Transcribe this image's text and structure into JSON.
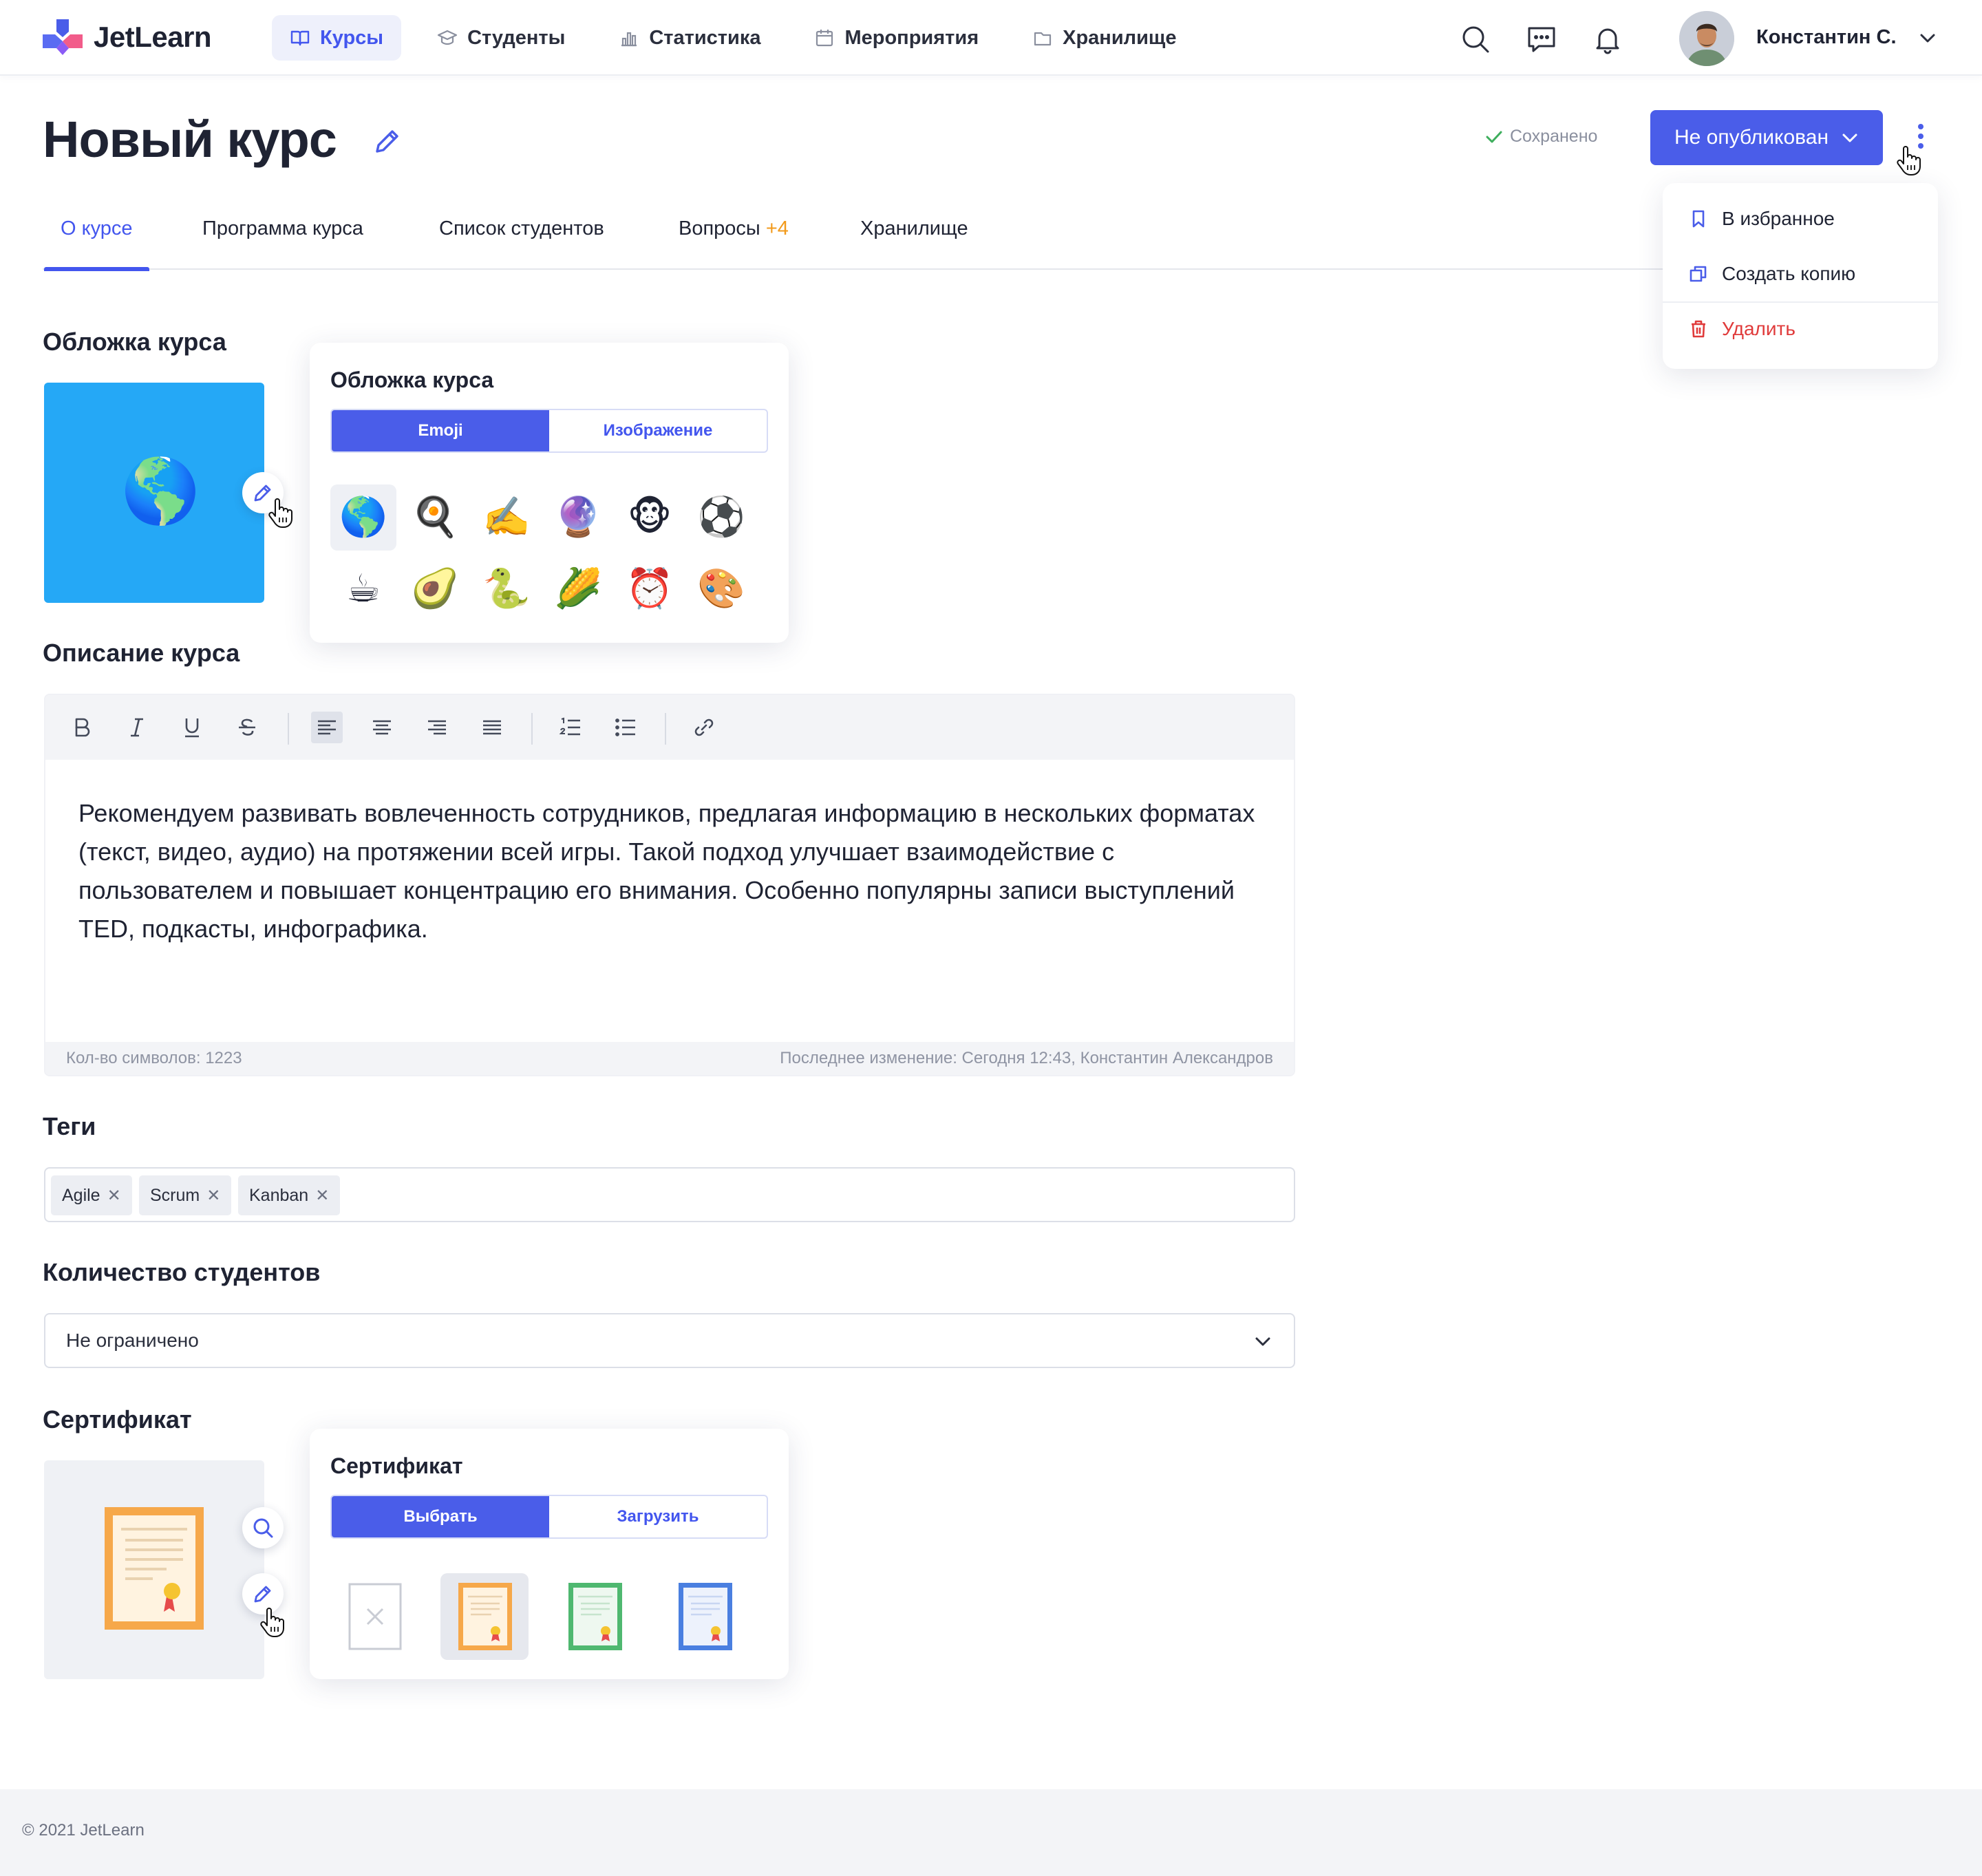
{
  "app": {
    "logo_text": "JetLearn"
  },
  "nav": {
    "items": [
      {
        "label": "Курсы",
        "icon": "book-icon",
        "active": true
      },
      {
        "label": "Студенты",
        "icon": "graduation-cap-icon",
        "active": false
      },
      {
        "label": "Статистика",
        "icon": "bar-chart-icon",
        "active": false
      },
      {
        "label": "Мероприятия",
        "icon": "calendar-icon",
        "active": false
      },
      {
        "label": "Хранилище",
        "icon": "folder-icon",
        "active": false
      }
    ]
  },
  "header_icons": [
    "search-icon",
    "chat-icon",
    "bell-icon"
  ],
  "user": {
    "name": "Константин С."
  },
  "page": {
    "title": "Новый курс",
    "saved_status": "Сохранено",
    "publish_label": "Не опубликован"
  },
  "tabs": [
    {
      "label": "О курсе",
      "active": true
    },
    {
      "label": "Программа курса"
    },
    {
      "label": "Список студентов"
    },
    {
      "label": "Вопросы",
      "count": "+4"
    },
    {
      "label": "Хранилище"
    }
  ],
  "more_menu": {
    "items": [
      {
        "label": "В избранное",
        "icon": "bookmark-icon"
      },
      {
        "label": "Создать копию",
        "icon": "copy-icon"
      },
      {
        "label": "Удалить",
        "icon": "trash-icon",
        "color": "#e03b3b"
      }
    ]
  },
  "cover": {
    "label": "Обложка курса",
    "popover": {
      "title": "Обложка курса",
      "tabs": [
        "Emoji",
        "Изображение"
      ],
      "active_tab": "Emoji",
      "emojis": [
        "🌎",
        "🍳",
        "✍️",
        "🔮",
        "🐵",
        "⚽",
        "☕",
        "🥑",
        "🐍",
        "🌽",
        "⏰",
        "🎨"
      ],
      "selected_index": 0
    },
    "current_emoji": "🌎",
    "background_color": "#25a8f6"
  },
  "description": {
    "label": "Описание курса",
    "toolbar": [
      "bold-icon",
      "italic-icon",
      "underline-icon",
      "strikethrough-icon",
      "align-left-icon",
      "align-center-icon",
      "align-right-icon",
      "align-justify-icon",
      "ordered-list-icon",
      "bullet-list-icon",
      "link-icon"
    ],
    "active_tool": "align-left-icon",
    "text": "Рекомендуем развивать вовлеченность сотрудников, предлагая информацию в нескольких форматах (текст, видео, аудио) на протяжении всей игры. Такой подход улучшает взаимодействие с пользователем и повышает концентрацию его внимания. Особенно популярны записи выступлений TED, подкасты, инфографика.",
    "char_count": "Кол-во символов: 1223",
    "last_change": "Последнее изменение: Сегодня 12:43, Константин Александров"
  },
  "tags": {
    "label": "Теги",
    "items": [
      "Agile",
      "Scrum",
      "Kanban"
    ]
  },
  "students": {
    "label": "Количество студентов",
    "value": "Не ограничено"
  },
  "certificate": {
    "label": "Сертификат",
    "popover": {
      "title": "Сертификат",
      "tabs": [
        "Выбрать",
        "Загрузить"
      ],
      "active_tab": "Выбрать",
      "options": [
        "none",
        "orange",
        "green",
        "blue"
      ],
      "selected_index": 1
    }
  },
  "colors": {
    "accent": "#4a5de9",
    "counter": "#f29a1b",
    "danger": "#e03b3b",
    "cert_orange": "#f6a84a",
    "cert_green": "#4fb870",
    "cert_blue": "#4a7fe0"
  },
  "footer": {
    "copyright": "© 2021 JetLearn"
  }
}
